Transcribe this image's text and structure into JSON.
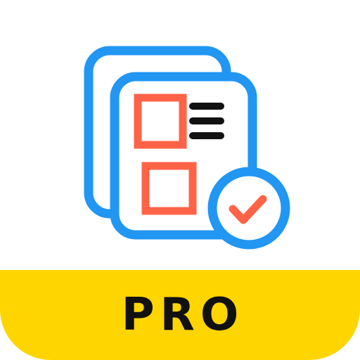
{
  "app_icon": {
    "badge_text": "PRO",
    "colors": {
      "background": "#ffffff",
      "document_stroke": "#2196F3",
      "checkbox_stroke": "#FF6347",
      "lines": "#111111",
      "banner": "#FFD500",
      "check": "#FF6347"
    },
    "icons": [
      "stacked-documents-icon",
      "checkbox-list-icon",
      "checkmark-badge-icon"
    ]
  }
}
